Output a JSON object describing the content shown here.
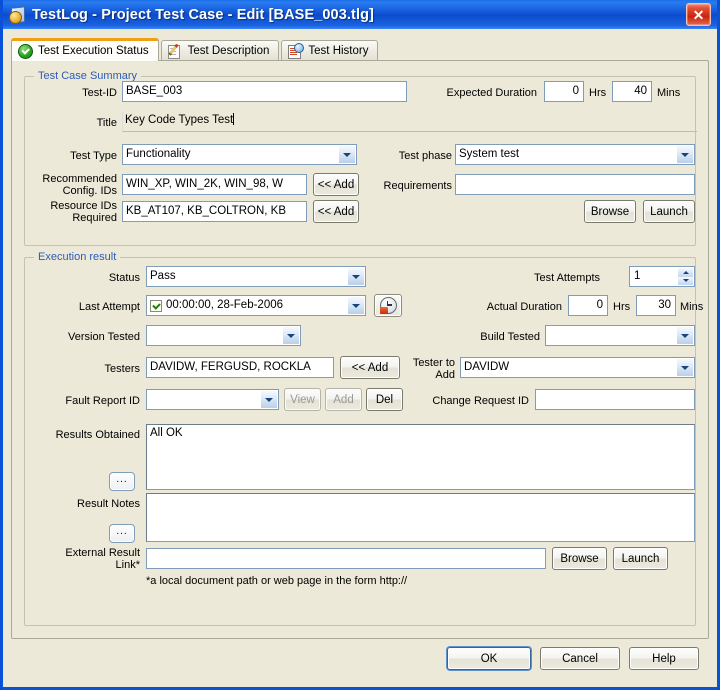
{
  "window": {
    "title": "TestLog - Project Test Case - Edit [BASE_003.tlg]",
    "close_label": "✕",
    "app_icon": "testlog-document-icon"
  },
  "tabs": [
    {
      "label": "Test Execution Status",
      "icon": "green-check-circle-icon",
      "active": true
    },
    {
      "label": "Test Description",
      "icon": "document-pencil-icon",
      "active": false
    },
    {
      "label": "Test History",
      "icon": "document-clock-icon",
      "active": false
    }
  ],
  "summary": {
    "legend": "Test Case Summary",
    "test_id_label": "Test-ID",
    "test_id_value": "BASE_003",
    "expected_duration_label": "Expected Duration",
    "expected_hrs_value": "0",
    "hrs_unit": "Hrs",
    "expected_mins_value": "40",
    "mins_unit": "Mins",
    "title_label": "Title",
    "title_value": "Key Code Types Test",
    "test_type_label": "Test Type",
    "test_type_value": "Functionality",
    "test_phase_label": "Test phase",
    "test_phase_value": "System test",
    "recommended_config_label_1": "Recommended",
    "recommended_config_label_2": "Config. IDs",
    "recommended_config_value": "WIN_XP, WIN_2K, WIN_98, W",
    "config_add_label": "<< Add",
    "requirements_label": "Requirements",
    "requirements_value": "",
    "resource_ids_label_1": "Resource IDs",
    "resource_ids_label_2": "Required",
    "resource_ids_value": "KB_AT107, KB_COLTRON, KB",
    "resource_add_label": "<< Add",
    "browse_label": "Browse",
    "launch_label": "Launch"
  },
  "execution": {
    "legend": "Execution result",
    "status_label": "Status",
    "status_value": "Pass",
    "test_attempts_label": "Test Attempts",
    "test_attempts_value": "1",
    "last_attempt_label": "Last Attempt",
    "last_attempt_value": "00:00:00, 28-Feb-2006",
    "last_attempt_checked": true,
    "attempt_icon_button": "alarm-clock-icon",
    "actual_duration_label": "Actual Duration",
    "actual_hrs_value": "0",
    "hrs_unit": "Hrs",
    "actual_mins_value": "30",
    "mins_unit": "Mins",
    "version_tested_label": "Version Tested",
    "version_tested_value": "",
    "build_tested_label": "Build Tested",
    "build_tested_value": "",
    "testers_label": "Testers",
    "testers_value": "DAVIDW, FERGUSD, ROCKLA",
    "testers_add_label": "<< Add",
    "tester_to_add_label_1": "Tester to",
    "tester_to_add_label_2": "Add",
    "tester_to_add_value": "DAVIDW",
    "fault_report_label": "Fault Report ID",
    "fault_report_value": "",
    "view_label": "View",
    "add_label": "Add",
    "del_label": "Del",
    "change_request_label": "Change Request ID",
    "change_request_value": "",
    "results_obtained_label": "Results Obtained",
    "results_obtained_value": "All OK",
    "results_dots_label": "...",
    "result_notes_label": "Result Notes",
    "result_notes_value": "",
    "notes_dots_label": "...",
    "external_link_label_1": "External Result",
    "external_link_label_2": "Link*",
    "external_link_value": "",
    "external_browse_label": "Browse",
    "external_launch_label": "Launch",
    "hint": "*a local document path or web page in the form http://"
  },
  "footer": {
    "ok_label": "OK",
    "cancel_label": "Cancel",
    "help_label": "Help"
  },
  "colors": {
    "titlebar_blue": "#0c4ccc",
    "window_border": "#0a51d8",
    "face": "#ece9d8",
    "legend_text": "#2f5bb5",
    "active_tab_accent": "#f0a014",
    "close_red": "#c9240c"
  }
}
